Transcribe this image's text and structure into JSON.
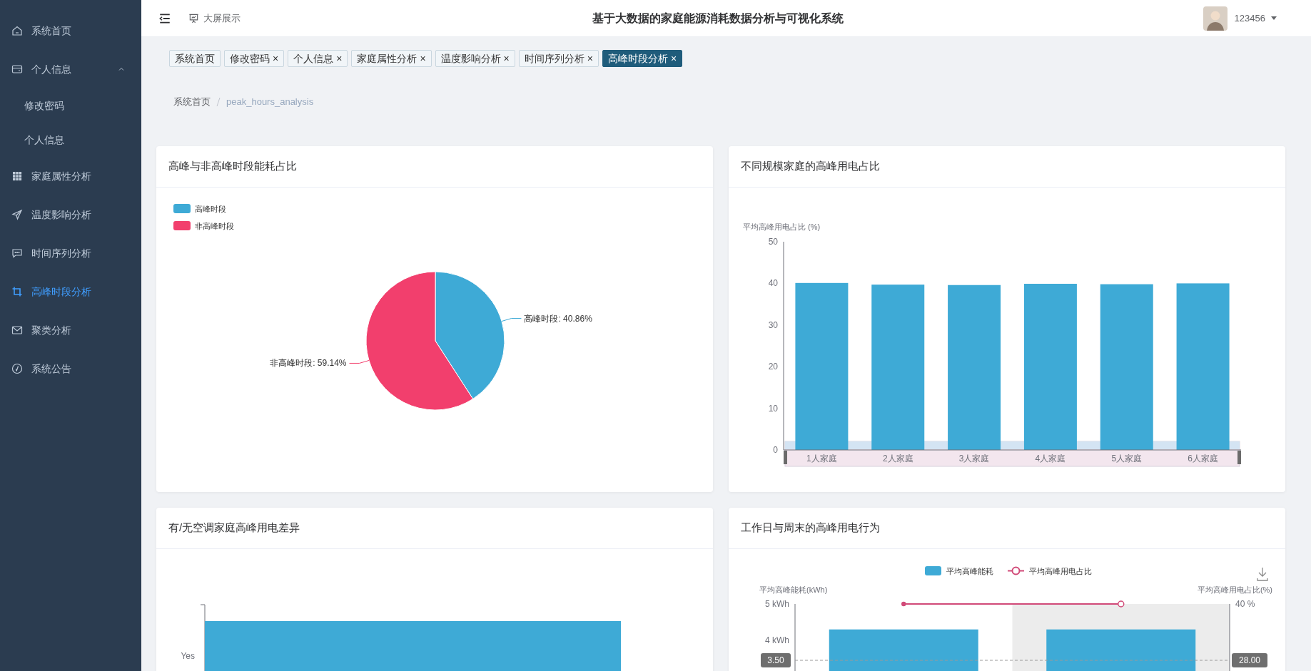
{
  "sidebar": {
    "items": [
      {
        "label": "系统首页",
        "selected": false
      },
      {
        "label": "个人信息",
        "selected": false,
        "expanded": true,
        "children": [
          {
            "label": "修改密码",
            "selected": false
          },
          {
            "label": "个人信息",
            "selected": false
          }
        ]
      },
      {
        "label": "家庭属性分析",
        "selected": false
      },
      {
        "label": "温度影响分析",
        "selected": false
      },
      {
        "label": "时间序列分析",
        "selected": false
      },
      {
        "label": "高峰时段分析",
        "selected": true
      },
      {
        "label": "聚类分析",
        "selected": false
      },
      {
        "label": "系统公告",
        "selected": false
      }
    ]
  },
  "header": {
    "screen_link": "大屏展示",
    "title": "基于大数据的家庭能源消耗数据分析与可视化系统",
    "user": "123456"
  },
  "tabs": [
    {
      "label": "系统首页",
      "closable": false,
      "selected": false
    },
    {
      "label": "修改密码",
      "closable": true,
      "selected": false
    },
    {
      "label": "个人信息",
      "closable": true,
      "selected": false
    },
    {
      "label": "家庭属性分析",
      "closable": true,
      "selected": false
    },
    {
      "label": "温度影响分析",
      "closable": true,
      "selected": false
    },
    {
      "label": "时间序列分析",
      "closable": true,
      "selected": false
    },
    {
      "label": "高峰时段分析",
      "closable": true,
      "selected": true
    }
  ],
  "close_symbol": "×",
  "breadcrumb": [
    "系统首页",
    "peak_hours_analysis"
  ],
  "cards": [
    {
      "title": "高峰与非高峰时段能耗占比",
      "chart_data": {
        "type": "pie",
        "legend": "upper left",
        "categories": [
          "高峰时段",
          "非高峰时段"
        ],
        "values": [
          40.86,
          59.14
        ],
        "colors": [
          "#3eaad6",
          "#f23f6d"
        ],
        "value_labels": [
          "高峰时段: 40.86%",
          "非高峰时段: 59.14%"
        ]
      }
    },
    {
      "title": "不同规模家庭的高峰用电占比",
      "chart_data": {
        "type": "bar",
        "ylabel": "平均高峰用电占比 (%)",
        "categories": [
          "1人家庭",
          "2人家庭",
          "3人家庭",
          "4人家庭",
          "5人家庭",
          "6人家庭"
        ],
        "values": [
          40.1,
          39.7,
          39.6,
          39.9,
          39.8,
          40.0
        ],
        "color": "#3eaad6",
        "ylim": [
          0,
          50
        ],
        "yticks": [
          0,
          10,
          20,
          30,
          40,
          50
        ]
      }
    },
    {
      "kind": "hbar",
      "title": "有/无空调家庭高峰用电差异",
      "axis_labels": [
        "Yes"
      ]
    },
    {
      "title": "工作日与周末的高峰用电行为",
      "line_legend": "平均高峰用电占比",
      "y2label": "平均高峰用电占比(%)",
      "y2_tick": "40 %",
      "pointer_labels": [
        "3.50",
        "28.00"
      ],
      "hover_columns": [
        {
          "selected": false
        },
        {
          "selected": true
        }
      ],
      "chart_data": {
        "type": "bar",
        "ylabel": "平均高峰能耗(kWh)",
        "ylim": [
          0,
          5
        ],
        "legend": "upper center",
        "series": [
          {
            "name": "平均高峰能耗",
            "color": "#3eaad6",
            "values": [
              4.3,
              4.3
            ]
          }
        ],
        "yticks": [
          {
            "value": 5,
            "label": "5 kWh"
          },
          {
            "value": 4,
            "label": "4 kWh"
          }
        ]
      }
    }
  ]
}
